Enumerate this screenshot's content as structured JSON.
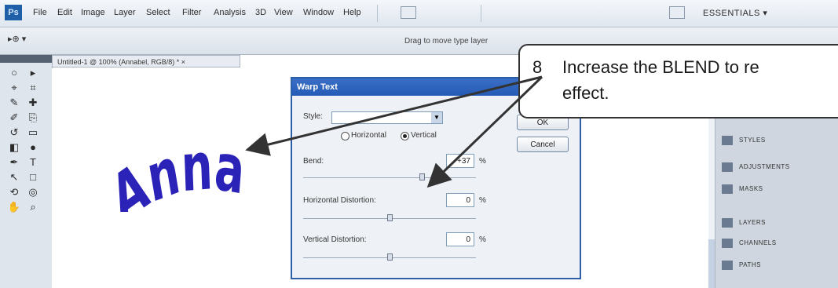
{
  "menu": {
    "logo": "Ps",
    "items": [
      "File",
      "Edit",
      "Image",
      "Layer",
      "Select",
      "Filter",
      "Analysis",
      "3D",
      "View",
      "Window",
      "Help"
    ],
    "workspace": "ESSENTIALS ▾"
  },
  "options": {
    "tool": "▸⊕ ▾",
    "hint": "Drag to move type layer"
  },
  "document": {
    "tab_title": "Untitled-1 @ 100% (Annabel, RGB/8) * ×",
    "art_text": "Annabel",
    "art_color": "#2b22b8"
  },
  "dialog": {
    "title": "Warp Text",
    "style_label": "Style:",
    "style_value": "",
    "horizontal_label": "Horizontal",
    "vertical_label": "Vertical",
    "orientation_selected": "Vertical",
    "bend_label": "Bend:",
    "bend_value": "+37",
    "bend_percent": 37,
    "hdist_label": "Horizontal Distortion:",
    "hdist_value": "0",
    "vdist_label": "Vertical Distortion:",
    "vdist_value": "0",
    "percent": "%",
    "ok_label": "OK",
    "cancel_label": "Cancel"
  },
  "panels": {
    "items": [
      "STYLES",
      "ADJUSTMENTS",
      "MASKS",
      "LAYERS",
      "CHANNELS",
      "PATHS"
    ]
  },
  "callout": {
    "number": "8",
    "line1": "Increase the BLEND to re",
    "line2": "effect."
  },
  "colors": {
    "accent": "#245bb7",
    "art": "#2b22b8"
  }
}
